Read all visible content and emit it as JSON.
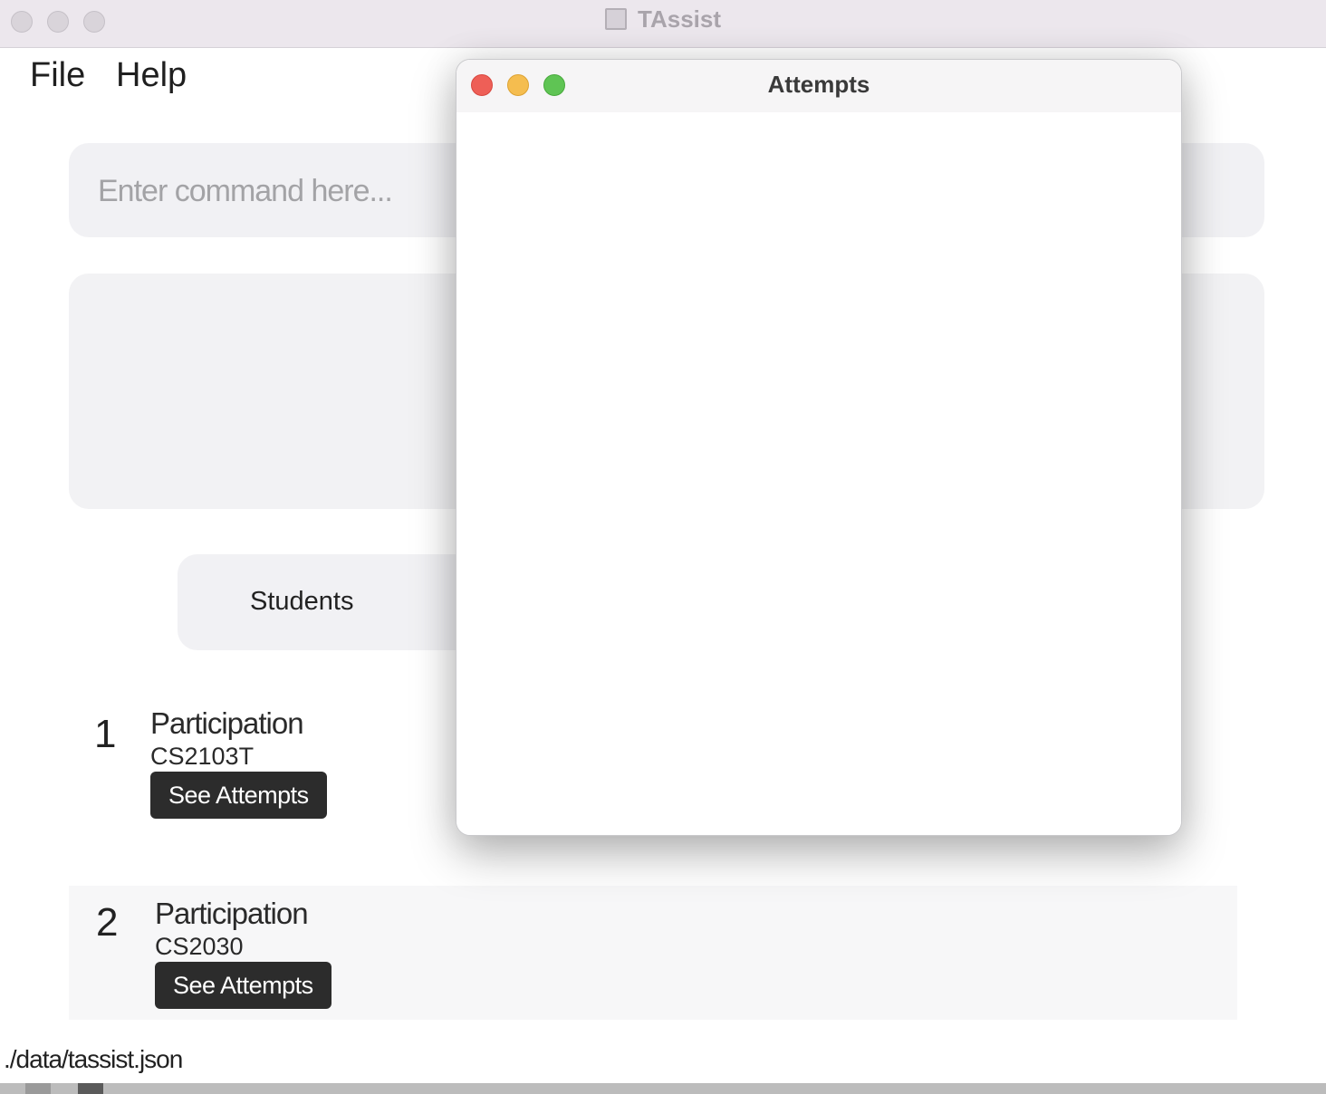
{
  "app": {
    "title": "TAssist"
  },
  "menu": {
    "file": "File",
    "help": "Help"
  },
  "command": {
    "placeholder": "Enter command here...",
    "value": ""
  },
  "tabs": {
    "students": "Students"
  },
  "list": [
    {
      "index": "1",
      "title": "Participation",
      "module": "CS2103T",
      "button": "See Attempts"
    },
    {
      "index": "2",
      "title": "Participation",
      "module": "CS2030",
      "button": "See Attempts"
    }
  ],
  "status": {
    "path": "./data/tassist.json"
  },
  "popup": {
    "title": "Attempts"
  },
  "colors": {
    "close": "#ee5f57",
    "minimize": "#f5bd4f",
    "zoom": "#5fc454",
    "button_bg": "#2c2c2c"
  }
}
